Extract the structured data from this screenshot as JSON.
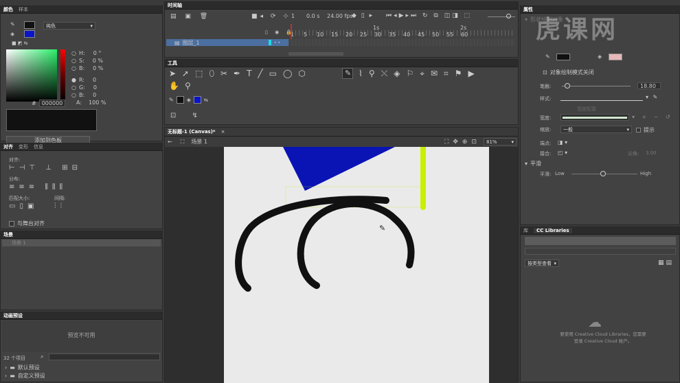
{
  "color_panel": {
    "tab_color": "颜色",
    "tab_swatches": "样本",
    "fill_type": "纯色",
    "h_label": "H:",
    "h_val": "0 °",
    "s_label": "S:",
    "s_val": "0 %",
    "b_label": "B:",
    "b_val": "0 %",
    "r_label": "R:",
    "r_val": "0",
    "g_label": "G:",
    "g_val": "0",
    "b2_label": "B:",
    "b2_val": "0",
    "hex_label": "#",
    "hex_val": "000000",
    "alpha_label": "A:",
    "alpha_val": "100 %",
    "add_btn": "添加到色板",
    "stroke_color": "#111111",
    "fill_color": "#0a14c8"
  },
  "align_panel": {
    "tab_align": "对齐",
    "tab_transform": "变形",
    "tab_info": "信息",
    "align_label": "对齐:",
    "distribute_label": "分布:",
    "match_label": "匹配大小:",
    "spacing_label": "间隔:",
    "stage_align": "与舞台对齐"
  },
  "scene_panel": {
    "title": "场景",
    "item": "场景 1"
  },
  "motion_panel": {
    "title": "动画预设",
    "preview": "预览不可用",
    "count": "32 个项目",
    "folders": [
      "默认预设",
      "自定义预设"
    ]
  },
  "timeline": {
    "title": "时间轴",
    "frame": "1",
    "time": "0.0 s",
    "fps": "24.00 fps",
    "layer": "图层_1",
    "ruler": [
      "1",
      "5",
      "10",
      "15",
      "20",
      "25",
      "30",
      "35",
      "40",
      "45",
      "50",
      "55",
      "60"
    ],
    "sec_marks": [
      "1s",
      "2s"
    ]
  },
  "tools": {
    "title": "工具"
  },
  "document": {
    "tab": "无标题-1 (Canvas)*",
    "scene": "场景 1",
    "zoom": "81%"
  },
  "properties": {
    "title": "属性",
    "section_shape": "形状绘制对象",
    "object_mode": "对象绘制模式关闭",
    "stroke_label": "笔触:",
    "stroke_val": "18.80",
    "style_label": "样式:",
    "width_label": "宽度:",
    "scale_label": "缩放:",
    "scale_val": "一般",
    "hint_label": "提示",
    "cap_label": "端点:",
    "join_label": "接合:",
    "miter_label": "尖角:",
    "miter_val": "3.00",
    "smooth_section": "平滑",
    "smooth_label": "平滑:",
    "smooth_low": "Low",
    "smooth_high": "High",
    "edit_width": "宽度配置"
  },
  "library": {
    "tab_lib": "库",
    "tab_cc": "CC Libraries",
    "view_btn": "按类型查看",
    "msg1": "要使用 Creative Cloud Libraries，您需要",
    "msg2": "登录 Creative Cloud 帐户。"
  },
  "watermark": "虎课网",
  "colors": {
    "stroke_black": "#111111",
    "blue": "#0a14b4",
    "lime": "#c8f000",
    "stage": "#eaeaea"
  }
}
